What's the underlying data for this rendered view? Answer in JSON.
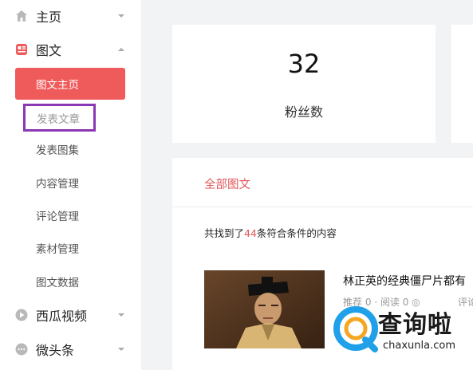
{
  "sidebar": {
    "items": [
      {
        "label": "主页",
        "icon": "home-icon"
      },
      {
        "label": "图文",
        "icon": "article-icon"
      },
      {
        "label": "西瓜视频",
        "icon": "play-icon"
      },
      {
        "label": "微头条",
        "icon": "chat-icon"
      }
    ],
    "subitems": [
      "图文主页",
      "发表文章",
      "发表图集",
      "内容管理",
      "评论管理",
      "素材管理",
      "图文数据"
    ]
  },
  "stats": {
    "followers_value": "32",
    "followers_label": "粉丝数"
  },
  "content": {
    "tab_label": "全部图文",
    "found_prefix": "共找到了",
    "found_count": "44",
    "found_suffix": "条符合条件的内容",
    "article_title": "林正英的经典僵尸片都有",
    "article_meta": "推荐 0 · 阅读 0 ◎",
    "article_meta2": "评论"
  },
  "watermark": {
    "brand": "查询啦",
    "domain": "chaxunla.com"
  },
  "colors": {
    "accent": "#ef5a5a",
    "highlight_border": "#8a38b3",
    "background": "#f2f3f5"
  }
}
